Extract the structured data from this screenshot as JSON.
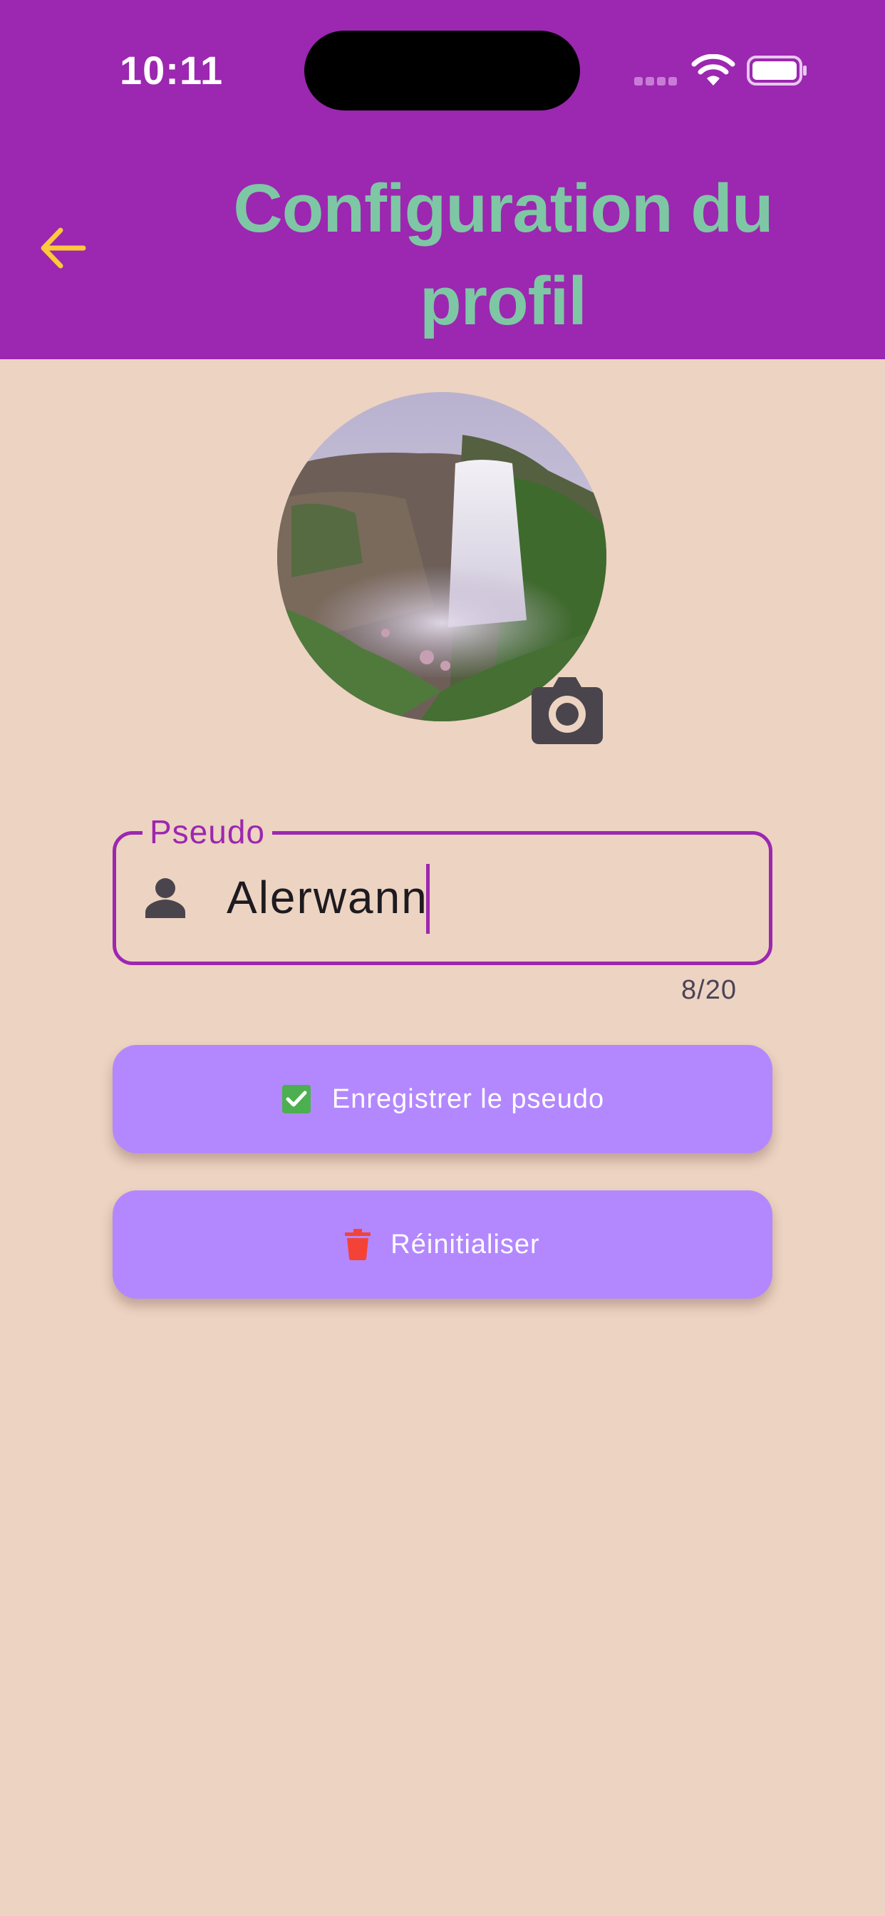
{
  "status_bar": {
    "time": "10:11"
  },
  "header": {
    "title": "Configuration du profil"
  },
  "profile": {
    "nickname_field": {
      "label": "Pseudo",
      "value": "Alerwann",
      "counter": "8/20"
    },
    "save_button_label": "Enregistrer le pseudo",
    "reset_button_label": "Réinitialiser"
  },
  "icons": {
    "back": "arrow-left-icon",
    "camera": "camera-icon",
    "person": "person-icon",
    "save": "checkbox-checked-icon",
    "reset": "trash-icon"
  },
  "colors": {
    "app_bar": "#9c27b0",
    "background": "#edd3c1",
    "title": "#7ec7a5",
    "back_arrow": "#ffc93c",
    "button": "#b388ff",
    "check": "#4caf50",
    "trash": "#f44336"
  }
}
